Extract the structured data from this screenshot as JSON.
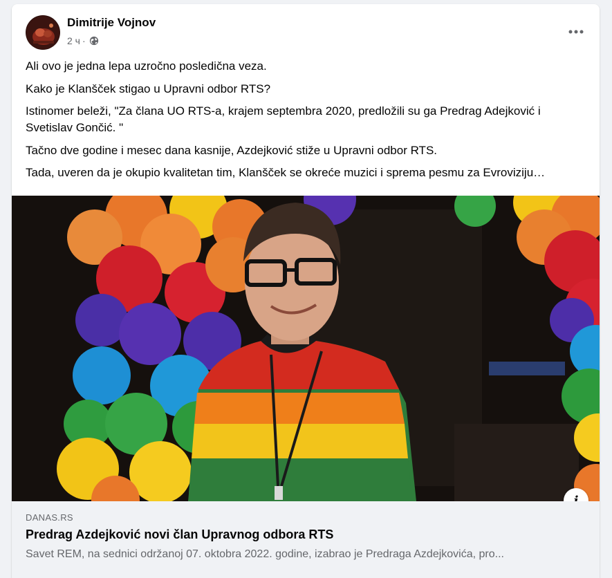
{
  "post": {
    "author": "Dimitrije Vojnov",
    "time": "2 ч",
    "separator": "·",
    "privacy_icon": "globe-icon",
    "more_icon": "more-options-icon",
    "paragraphs": [
      "Ali ovo je jedna lepa uzročno posledična veza.",
      "Kako je Klanšček stigao u Upravni odbor RTS?",
      "Istinomer beleži, \"Za člana UO RTS-a, krajem septembra 2020, predložili su ga Predrag Adejković i Svetislav Gončić. \"",
      "Tačno dve godine i mesec dana kasnije, Azdejković stiže u Upravni odbor RTS.",
      "Tada, uveren da je okupio kvalitetan tim, Klanšček se okreće muzici i sprema pesmu za Evroviziju…"
    ]
  },
  "link_preview": {
    "domain": "DANAS.RS",
    "title": "Predrag Azdejković novi član Upravnog odbora RTS",
    "description": "Savet REM, na sednici održanoj 07. oktobra 2022. godine, izabrao je Predraga Azdejkovića, pro...",
    "info_label": "i"
  },
  "colors": {
    "text_primary": "#050505",
    "text_secondary": "#65676b",
    "page_background": "#f0f2f5",
    "card_background": "#ffffff"
  }
}
